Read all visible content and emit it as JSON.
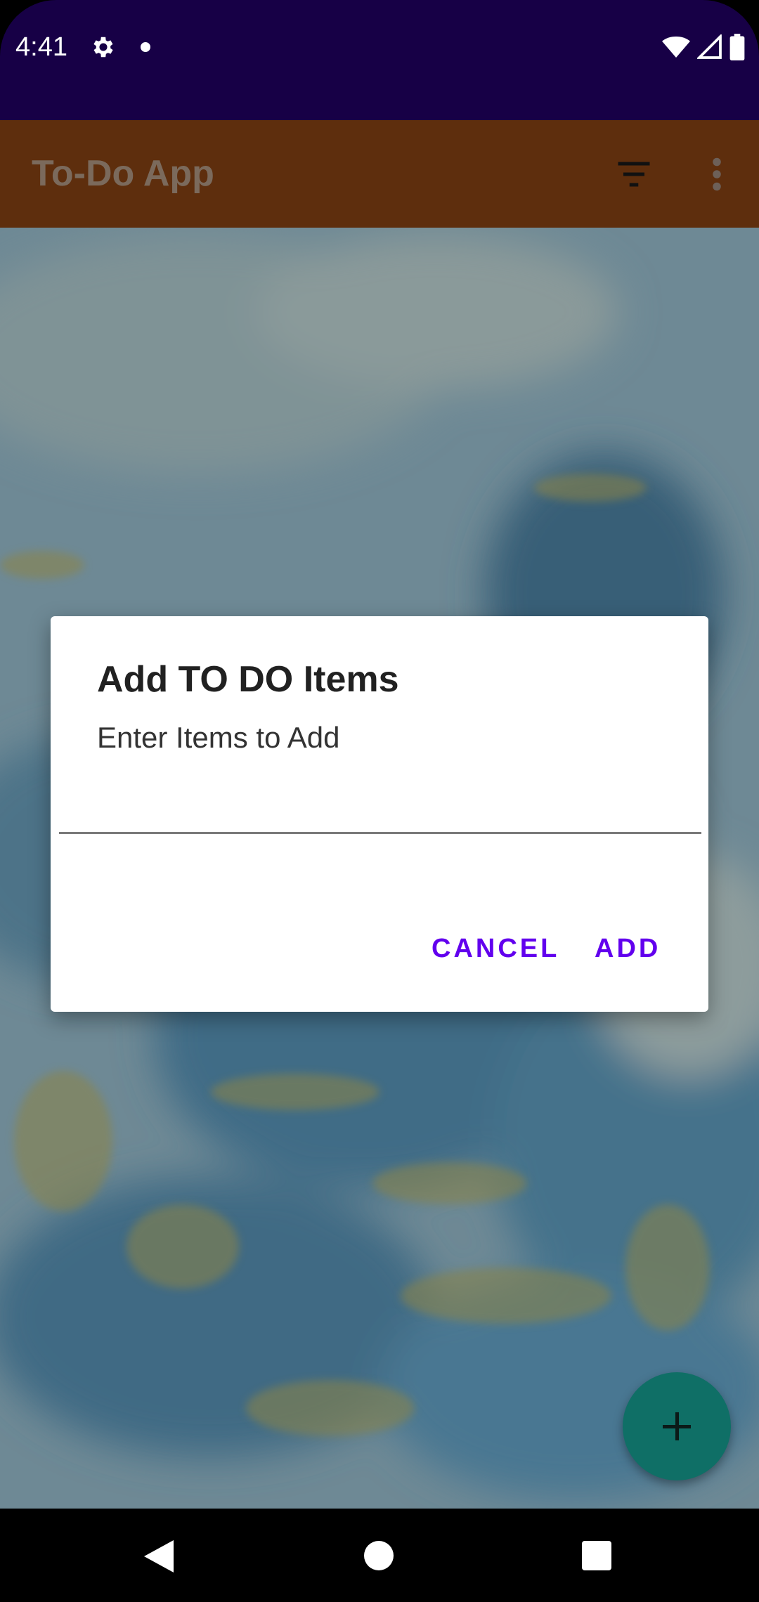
{
  "status_bar": {
    "time": "4:41",
    "icons": [
      "gear-icon",
      "notification-dot-icon",
      "wifi-icon",
      "signal-icon",
      "battery-icon"
    ]
  },
  "app_bar": {
    "title": "To-Do App",
    "actions": [
      "filter-icon",
      "more-vert-icon"
    ]
  },
  "dialog": {
    "title": "Add TO DO Items",
    "message": "Enter Items to Add",
    "input_value": "",
    "cancel_label": "CANCEL",
    "add_label": "ADD"
  },
  "fab": {
    "icon": "plus-icon"
  },
  "nav_bar": {
    "icons": [
      "back-icon",
      "home-icon",
      "recents-icon"
    ]
  },
  "colors": {
    "status_bar": "#170046",
    "app_bar": "#5e2e0d",
    "dialog_button": "#6200ee",
    "fab": "#0f6f66"
  }
}
